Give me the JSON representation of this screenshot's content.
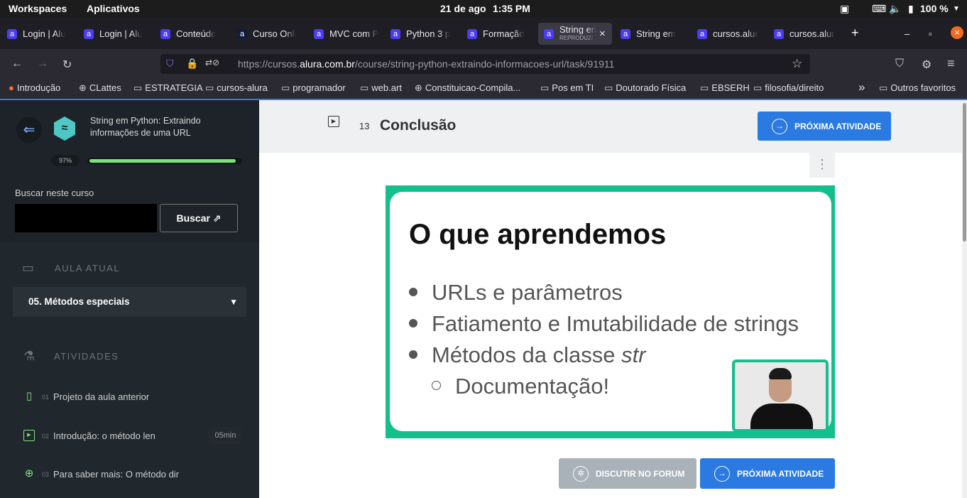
{
  "system": {
    "workspaces": "Workspaces",
    "apps": "Aplicativos",
    "date": "21 de ago",
    "time": "1:35 PM",
    "battery": "100 %"
  },
  "tabs": [
    {
      "title": "Login | Alu",
      "fav": "a"
    },
    {
      "title": "Login | Alu",
      "fav": "a"
    },
    {
      "title": "Conteúdo",
      "fav": "a"
    },
    {
      "title": "Curso Onli",
      "fav": "a"
    },
    {
      "title": "MVC com P",
      "fav": "a"
    },
    {
      "title": "Python 3 p",
      "fav": "a"
    },
    {
      "title": "Formação",
      "fav": "a"
    },
    {
      "title": "String em",
      "sub": "REPRODUZI",
      "fav": "a",
      "close": "×"
    },
    {
      "title": "String em",
      "fav": "a"
    },
    {
      "title": "cursos.alur",
      "fav": "a"
    },
    {
      "title": "cursos.alur",
      "fav": "a"
    }
  ],
  "new_tab": "+",
  "window": {
    "min": "–",
    "max": "▫",
    "close": "×"
  },
  "nav": {
    "back": "←",
    "forward": "→",
    "reload": "↻",
    "pocket": "⛉",
    "extension": "⚙",
    "menu": "≡",
    "star": "☆"
  },
  "url": {
    "prefix": "https://cursos.",
    "domain": "alura.com.br",
    "path": "/course/string-python-extraindo-informacoes-url/task/91911"
  },
  "bookmarks": [
    {
      "label": "Introdução",
      "icon": "●"
    },
    {
      "label": "CLattes",
      "icon": "⊕"
    },
    {
      "label": "ESTRATEGIA",
      "icon": "▭"
    },
    {
      "label": "cursos-alura",
      "icon": "▭"
    },
    {
      "label": "programador",
      "icon": "▭"
    },
    {
      "label": "web.art",
      "icon": "▭"
    },
    {
      "label": "Constituicao-Compila...",
      "icon": "⊕"
    },
    {
      "label": "Pos em TI",
      "icon": "▭"
    },
    {
      "label": "Doutorado Física",
      "icon": "▭"
    },
    {
      "label": "EBSERH",
      "icon": "▭"
    },
    {
      "label": "filosofia/direito",
      "icon": "▭"
    },
    {
      "label": "»",
      "icon": ""
    },
    {
      "label": "Outros favoritos",
      "icon": "▭"
    }
  ],
  "sidebar": {
    "back_icon": "⇐",
    "course_title": "String em Python: Extraindo informações de uma URL",
    "progress_label": "97%",
    "progress": 0.97,
    "search_label": "Buscar neste curso",
    "search_button": "Buscar ⇗",
    "aula_atual_label": "AULA ATUAL",
    "aula_selected": "05. Métodos especiais",
    "atividades_label": "ATIVIDADES",
    "activities": [
      {
        "num": "01",
        "label": "Projeto da aula anterior",
        "icon": "▯",
        "duration": ""
      },
      {
        "num": "02",
        "label": "Introdução: o método len",
        "icon": "▶",
        "duration": "05min"
      },
      {
        "num": "03",
        "label": "Para saber mais: O método dir",
        "icon": "⊕",
        "duration": ""
      }
    ]
  },
  "main": {
    "lesson_num": "13",
    "lesson_title": "Conclusão",
    "next_button": "PRÓXIMA ATIVIDADE",
    "forum_button": "DISCUTIR NO FORUM",
    "menu_dots": "⋮",
    "slide": {
      "title": "O que aprendemos",
      "bullets": [
        "URLs e parâmetros",
        "Fatiamento e Imutabilidade de strings",
        "Métodos da classe "
      ],
      "bullet3_italic": "str",
      "sub_bullet": "Documentação!"
    }
  },
  "colors": {
    "accent": "#2a7ae2",
    "slide_green": "#13c08d",
    "progress_green": "#7ee07e"
  }
}
